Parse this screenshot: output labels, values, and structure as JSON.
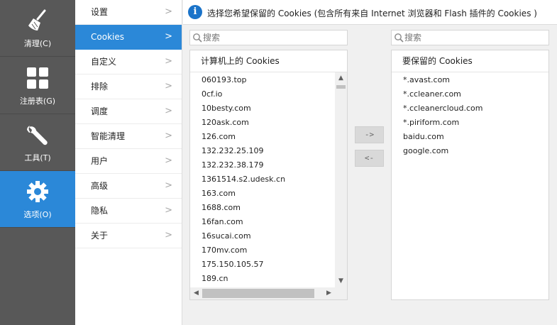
{
  "nav": [
    {
      "id": "clean",
      "label": "清理(C)",
      "icon": "broom-icon"
    },
    {
      "id": "registry",
      "label": "注册表(G)",
      "icon": "grid-icon"
    },
    {
      "id": "tools",
      "label": "工具(T)",
      "icon": "wrench-icon"
    },
    {
      "id": "options",
      "label": "选项(O)",
      "icon": "gear-icon",
      "active": true
    }
  ],
  "submenu": [
    {
      "label": "设置"
    },
    {
      "label": "Cookies",
      "active": true
    },
    {
      "label": "自定义"
    },
    {
      "label": "排除"
    },
    {
      "label": "调度"
    },
    {
      "label": "智能清理"
    },
    {
      "label": "用户"
    },
    {
      "label": "高级"
    },
    {
      "label": "隐私"
    },
    {
      "label": "关于"
    }
  ],
  "header": {
    "text": "选择您希望保留的 Cookies (包含所有来自 Internet 浏览器和 Flash 插件的 Cookies )"
  },
  "left_search": {
    "placeholder": "搜索",
    "value": ""
  },
  "right_search": {
    "placeholder": "搜索",
    "value": ""
  },
  "left_list": {
    "title": "计算机上的 Cookies",
    "items": [
      "060193.top",
      "0cf.io",
      "10besty.com",
      "120ask.com",
      "126.com",
      "132.232.25.109",
      "132.232.38.179",
      "1361514.s2.udesk.cn",
      "163.com",
      "1688.com",
      "16fan.com",
      "16sucai.com",
      "170mv.com",
      "175.150.105.57",
      "189.cn"
    ]
  },
  "right_list": {
    "title": "要保留的 Cookies",
    "items": [
      "*.avast.com",
      "*.ccleaner.com",
      "*.ccleanercloud.com",
      "*.piriform.com",
      "baidu.com",
      "google.com"
    ]
  },
  "buttons": {
    "move_right": "->",
    "move_left": "<-"
  },
  "colors": {
    "accent": "#2b88d8",
    "sidebar_bg": "#585858",
    "info_icon": "#1a73c9"
  }
}
